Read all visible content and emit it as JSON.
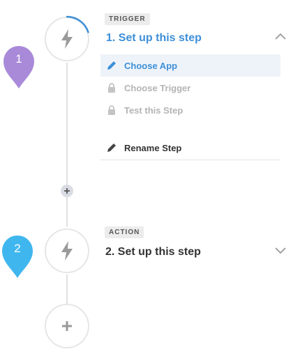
{
  "colors": {
    "accent_blue": "#3d8fd8",
    "marker_purple": "#a98ad9",
    "marker_blue": "#3fb7ee",
    "muted_gray": "#b4b4b4",
    "line_gray": "#e0e0e0"
  },
  "markers": [
    {
      "number": "1",
      "color": "#a98ad9"
    },
    {
      "number": "2",
      "color": "#3fb7ee"
    }
  ],
  "steps": [
    {
      "badge": "TRIGGER",
      "title": "1. Set up this step",
      "icon": "lightning-bolt-icon",
      "expanded": true,
      "progress": 0.2,
      "sub_items": [
        {
          "label": "Choose App",
          "icon": "pencil-icon",
          "state": "active"
        },
        {
          "label": "Choose Trigger",
          "icon": "lock-icon",
          "state": "disabled"
        },
        {
          "label": "Test this Step",
          "icon": "lock-icon",
          "state": "disabled"
        },
        {
          "label": "Rename Step",
          "icon": "pencil-icon",
          "state": "normal"
        }
      ]
    },
    {
      "badge": "ACTION",
      "title": "2. Set up this step",
      "icon": "lightning-bolt-icon",
      "expanded": false
    }
  ],
  "add_step_icon": "plus-icon",
  "insert_step_icon": "plus-icon"
}
